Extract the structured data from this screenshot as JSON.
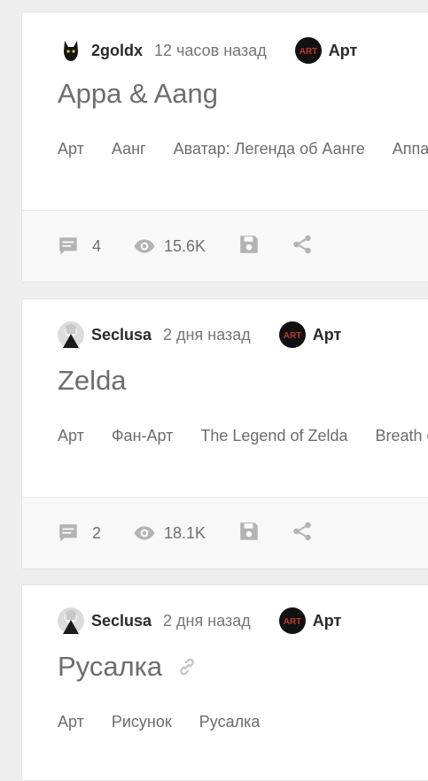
{
  "posts": [
    {
      "author": "2goldx",
      "time": "12 часов назад",
      "category": "Арт",
      "category_logo_text": "ART",
      "title": "Appa & Aang",
      "tags": [
        "Арт",
        "Аанг",
        "Аватар: Легенда об Аанге",
        "Аппа"
      ],
      "comments": "4",
      "views": "15.6K"
    },
    {
      "author": "Seclusa",
      "time": "2 дня назад",
      "category": "Арт",
      "category_logo_text": "ART",
      "title": "Zelda",
      "tags": [
        "Арт",
        "Фан-Арт",
        "The Legend of Zelda",
        "Breath of the Wild"
      ],
      "comments": "2",
      "views": "18.1K"
    },
    {
      "author": "Seclusa",
      "time": "2 дня назад",
      "category": "Арт",
      "category_logo_text": "ART",
      "title": "Русалка",
      "tags": [
        "Арт",
        "Рисунок",
        "Русалка"
      ]
    }
  ],
  "colors": {
    "icon_grey": "#b3b3b3",
    "art_logo_bg": "#111111"
  }
}
